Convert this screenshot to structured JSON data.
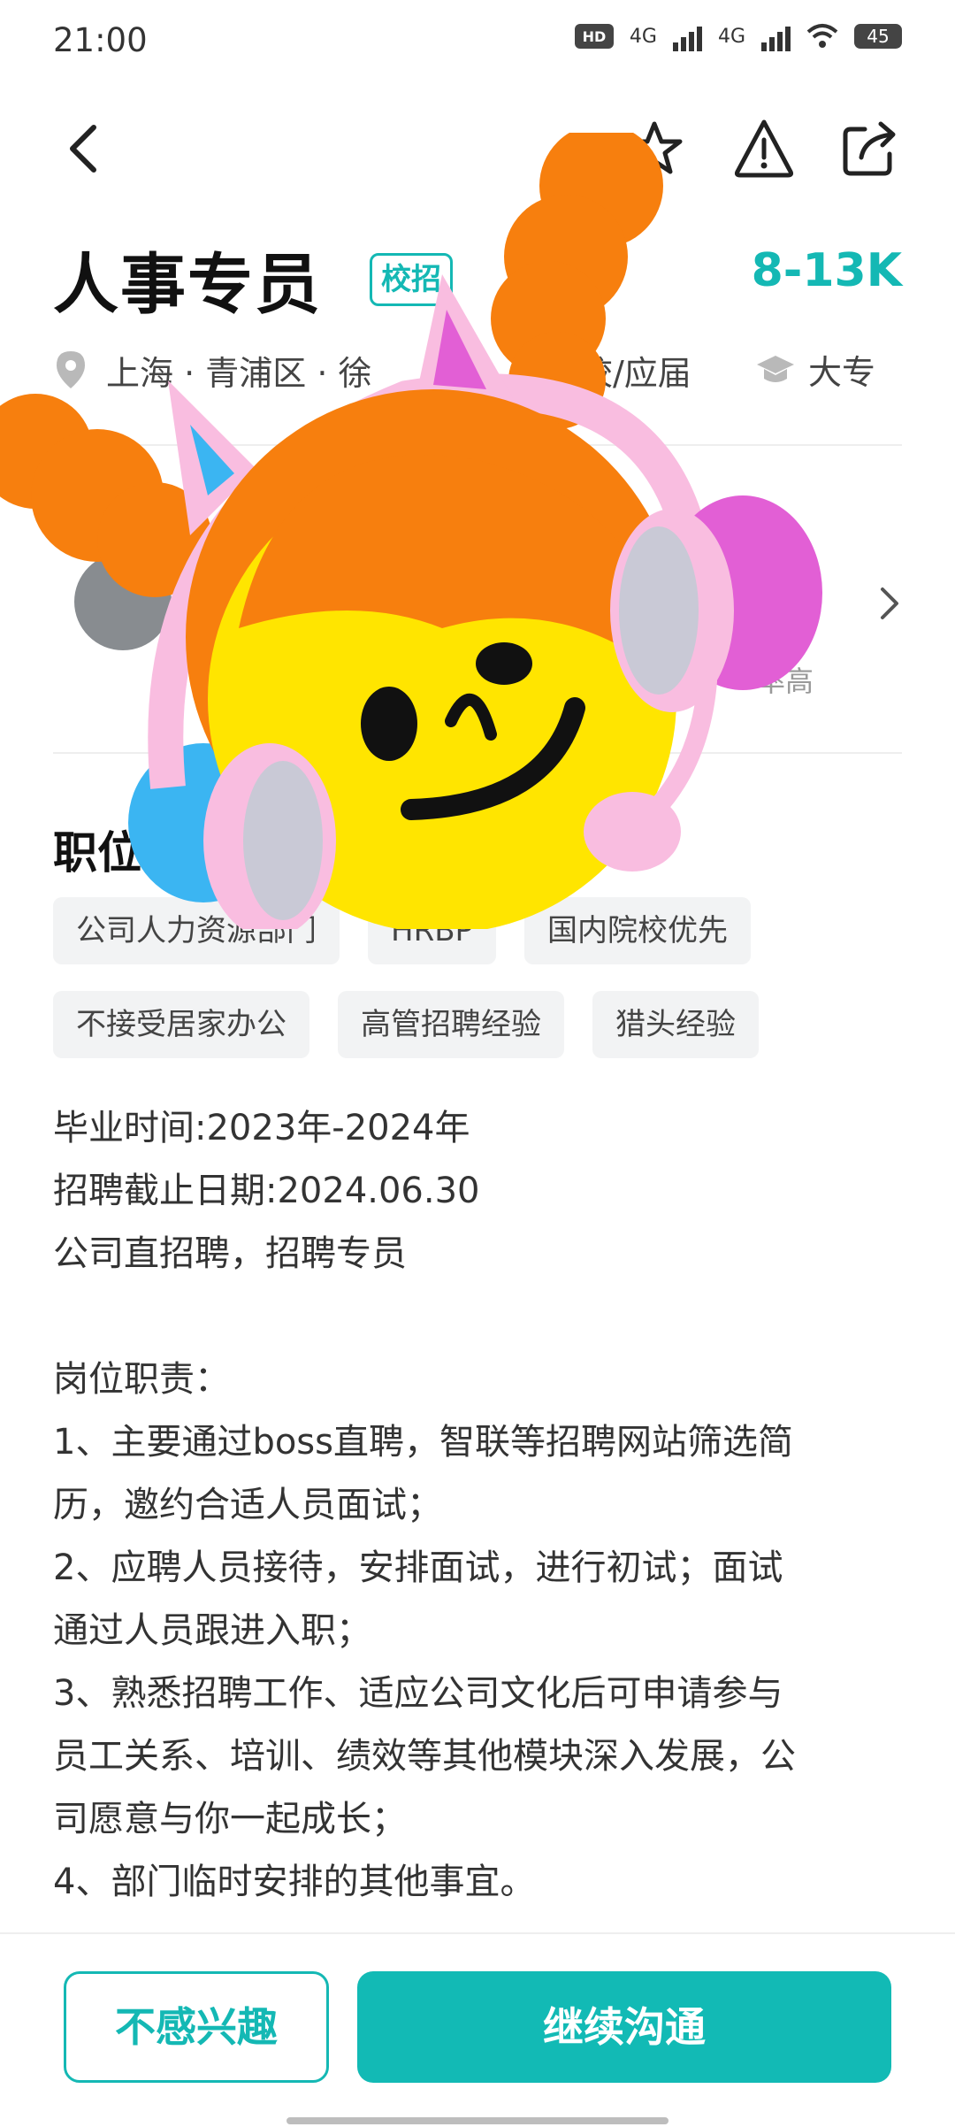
{
  "status_bar": {
    "time": "21:00",
    "network_1": "4G",
    "network_2": "4G",
    "battery": "45",
    "hd_label": "HD"
  },
  "nav": {
    "back_icon": "chevron-left-icon",
    "favorite_icon": "star-icon",
    "report_icon": "warning-icon",
    "share_icon": "share-icon"
  },
  "job": {
    "title": "人事专员",
    "badge": "校招",
    "salary": "8-13K",
    "location": "上海 · 青浦区 · 徐",
    "experience": "校/应届",
    "degree": "大专"
  },
  "recruiter": {
    "reply_rate": "率高"
  },
  "section": {
    "title": "职位"
  },
  "tags": [
    [
      "公司人力资源部门",
      "HRBP",
      "国内院校优先"
    ],
    [
      "不接受居家办公",
      "高管招聘经验",
      "猎头经验"
    ]
  ],
  "description": [
    "毕业时间:2023年-2024年",
    "招聘截止日期:2024.06.30",
    "公司直招聘，招聘专员",
    "",
    "岗位职责：",
    "1、主要通过boss直聘，智联等招聘网站筛选简",
    "历，邀约合适人员面试；",
    "2、应聘人员接待，安排面试，进行初试；面试",
    "通过人员跟进入职；",
    "3、熟悉招聘工作、适应公司文化后可申请参与",
    "员工关系、培训、绩效等其他模块深入发展，公",
    "司愿意与你一起成长；",
    "4、部门临时安排的其他事宜。"
  ],
  "actions": {
    "not_interested": "不感兴趣",
    "continue_chat": "继续沟通"
  },
  "colors": {
    "accent": "#14b8b4",
    "sticker_orange": "#f77f0e",
    "sticker_yellow": "#ffe500",
    "sticker_pink": "#f9bde0"
  }
}
